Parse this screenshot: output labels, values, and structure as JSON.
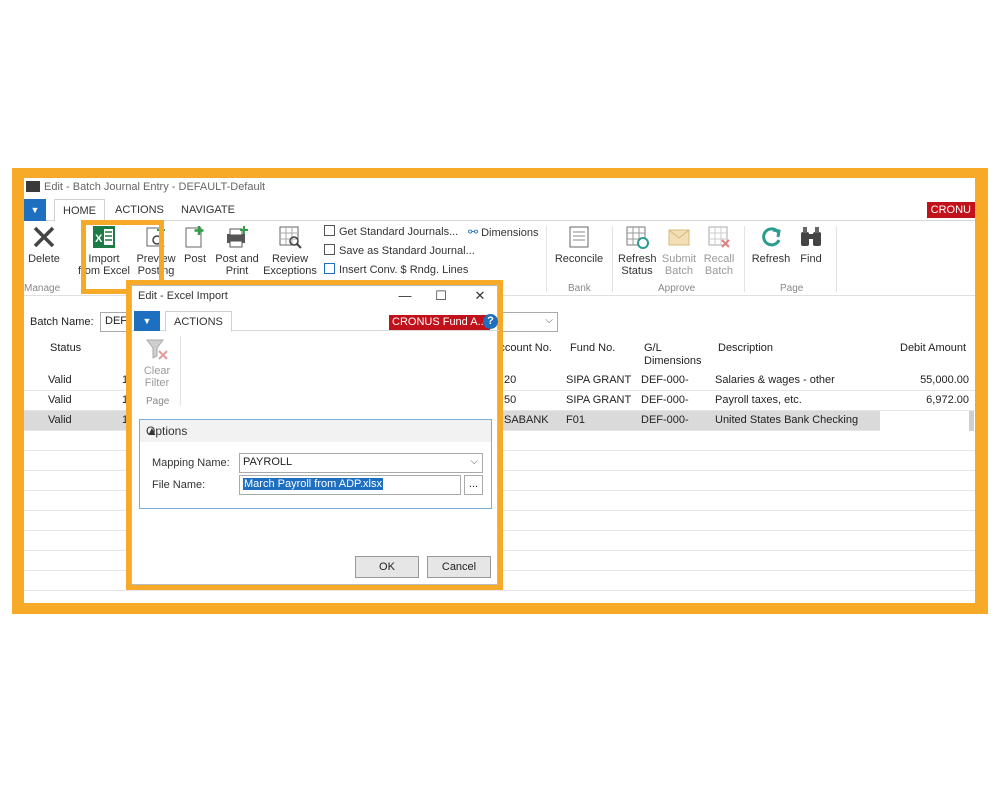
{
  "window": {
    "title": "Edit - Batch Journal Entry - DEFAULT-Default"
  },
  "tabs": [
    "HOME",
    "ACTIONS",
    "NAVIGATE"
  ],
  "company_badge": "CRONU",
  "ribbon": {
    "delete": "Delete",
    "import_from_excel": [
      "Import",
      "from Excel"
    ],
    "preview_posting": [
      "Preview",
      "Posting"
    ],
    "post": "Post",
    "post_and_print": [
      "Post and",
      "Print"
    ],
    "review_exceptions": [
      "Review",
      "Exceptions"
    ],
    "get_standard_journals": "Get Standard Journals...",
    "save_as_standard_journal": "Save as Standard Journal...",
    "insert_conv_rndg_lines": "Insert Conv. $ Rndg. Lines",
    "dimensions": "Dimensions",
    "reconcile": "Reconcile",
    "refresh_status": [
      "Refresh",
      "Status"
    ],
    "submit_batch": [
      "Submit",
      "Batch"
    ],
    "recall_batch": [
      "Recall",
      "Batch"
    ],
    "refresh": "Refresh",
    "find": "Find",
    "groups": {
      "manage": "Manage",
      "bank": "Bank",
      "approve": "Approve",
      "page": "Page"
    }
  },
  "batch": {
    "label": "Batch Name:",
    "value": "DEFA"
  },
  "grid": {
    "headers": {
      "status": "Status",
      "account_no": "Account No.",
      "fund_no": "Fund No.",
      "gl_dimensions": [
        "G/L",
        "Dimensions"
      ],
      "description": "Description",
      "debit_amount": "Debit Amount"
    },
    "rows": [
      {
        "status": "Valid",
        "c2": "1",
        "account": "20",
        "fund": "SIPA GRANT",
        "dims": "DEF-000-",
        "description": "Salaries & wages - other",
        "debit": "55,000.00"
      },
      {
        "status": "Valid",
        "c2": "1",
        "account": "50",
        "fund": "SIPA GRANT",
        "dims": "DEF-000-",
        "description": "Payroll taxes, etc.",
        "debit": "6,972.00"
      },
      {
        "status": "Valid",
        "c2": "1",
        "account": "SABANK",
        "fund": "F01",
        "dims": "DEF-000-",
        "description": "United States Bank Checking",
        "debit": ""
      }
    ]
  },
  "dialog": {
    "title": "Edit - Excel Import",
    "tab": "ACTIONS",
    "company": "CRONUS Fund A...",
    "help": "?",
    "clear_filter": [
      "Clear",
      "Filter"
    ],
    "page_group": "Page",
    "options_header": "Options",
    "mapping_label": "Mapping Name:",
    "mapping_value": "PAYROLL",
    "file_label": "File Name:",
    "file_value": "March Payroll from ADP.xlsx",
    "browse": "...",
    "ok": "OK",
    "cancel": "Cancel"
  },
  "colors": {
    "highlight": "#f7a928",
    "accent": "#1e6fbf",
    "company": "#c1121c"
  }
}
